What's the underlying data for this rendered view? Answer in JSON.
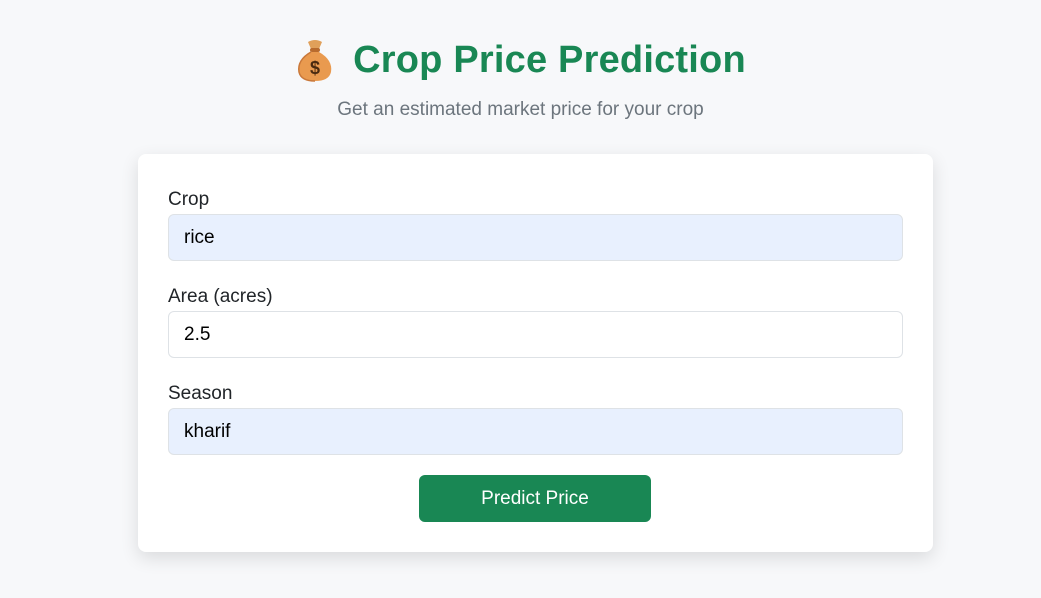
{
  "header": {
    "icon": "money-bag-icon",
    "title": "Crop Price Prediction",
    "subtitle": "Get an estimated market price for your crop"
  },
  "form": {
    "crop": {
      "label": "Crop",
      "value": "rice"
    },
    "area": {
      "label": "Area (acres)",
      "value": "2.5"
    },
    "season": {
      "label": "Season",
      "value": "kharif"
    },
    "submit_label": "Predict Price"
  },
  "colors": {
    "accent": "#198754",
    "page_background": "#f7f8fa",
    "autofill_background": "#e8f0fe",
    "subtitle": "#6c757d"
  }
}
